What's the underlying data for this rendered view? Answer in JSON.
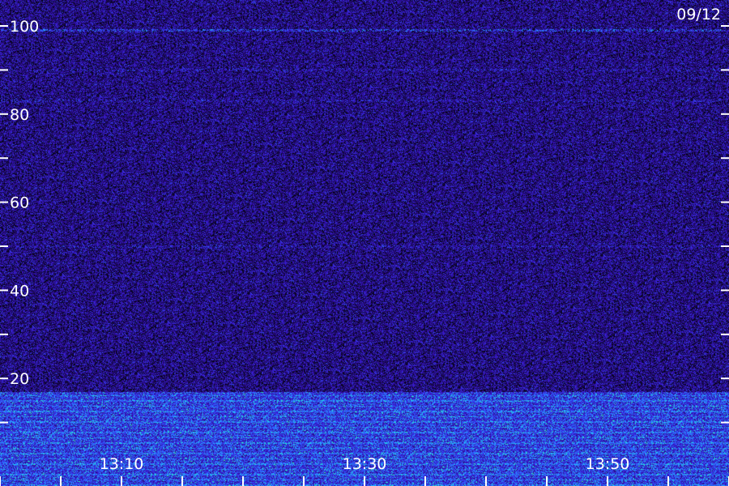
{
  "chart_data": {
    "type": "heatmap",
    "title": "",
    "date_label": "09/12",
    "xlabel": "",
    "ylabel": "",
    "x_axis": {
      "ticks": [
        "13:10",
        "13:30",
        "13:50"
      ],
      "minor_tick_interval_minutes": 5
    },
    "y_axis": {
      "range": [
        0,
        100
      ],
      "major_ticks": [
        20,
        40,
        60,
        80,
        100
      ],
      "minor_ticks": [
        10,
        30,
        50,
        70,
        90
      ]
    },
    "colormap": [
      "#000000",
      "#1a0a5a",
      "#3b12c8",
      "#2f5cff",
      "#22c4ff",
      "#32ff9a"
    ],
    "features": {
      "high_intensity_band_y": [
        0,
        17
      ],
      "persistent_lines_y": [
        99,
        90,
        83,
        50
      ]
    }
  }
}
